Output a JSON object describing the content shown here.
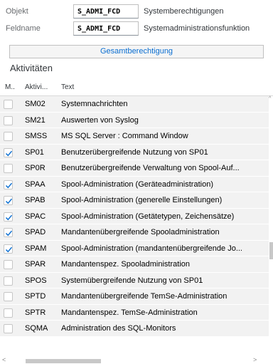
{
  "header": {
    "objekt_label": "Objekt",
    "objekt_value": "S_ADMI_FCD",
    "objekt_desc": "Systemberechtigungen",
    "feldname_label": "Feldname",
    "feldname_value": "S_ADMI_FCD",
    "feldname_desc": "Systemadministrationsfunktion"
  },
  "gesamt_button": "Gesamtberechtigung",
  "section_title": "Aktivitäten",
  "table": {
    "columns": [
      "M..",
      "Aktivi...",
      "Text"
    ],
    "rows": [
      {
        "checked": false,
        "code": "SM02",
        "text": "Systemnachrichten"
      },
      {
        "checked": false,
        "code": "SM21",
        "text": "Auswerten von Syslog"
      },
      {
        "checked": false,
        "code": "SMSS",
        "text": "MS SQL Server : Command Window"
      },
      {
        "checked": true,
        "code": "SP01",
        "text": "Benutzerübergreifende Nutzung von SP01"
      },
      {
        "checked": false,
        "code": "SP0R",
        "text": "Benutzerübergreifende Verwaltung von Spool-Auf..."
      },
      {
        "checked": true,
        "code": "SPAA",
        "text": "Spool-Administration (Geräteadministration)"
      },
      {
        "checked": true,
        "code": "SPAB",
        "text": "Spool-Administration (generelle Einstellungen)"
      },
      {
        "checked": true,
        "code": "SPAC",
        "text": "Spool-Administration (Getätetypen, Zeichensätze)"
      },
      {
        "checked": true,
        "code": "SPAD",
        "text": "Mandantenübergreifende Spooladministration"
      },
      {
        "checked": true,
        "code": "SPAM",
        "text": "Spool-Administration (mandantenübergreifende Jo..."
      },
      {
        "checked": false,
        "code": "SPAR",
        "text": "Mandantenspez. Spooladministration"
      },
      {
        "checked": false,
        "code": "SPOS",
        "text": "Systemübergreifende Nutzung von SP01"
      },
      {
        "checked": false,
        "code": "SPTD",
        "text": "Mandantenübergreifende TemSe-Administration"
      },
      {
        "checked": false,
        "code": "SPTR",
        "text": "Mandantenspez. TemSe-Administration"
      },
      {
        "checked": false,
        "code": "SQMA",
        "text": "Administration des SQL-Monitors"
      }
    ]
  },
  "colors": {
    "accent": "#0a6ed1",
    "check": "#0a6ed1",
    "row_bg": "#f2f2f2"
  }
}
